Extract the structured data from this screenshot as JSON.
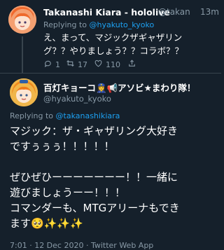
{
  "tweet1": {
    "display_name": "Takanashi Kiara - hololive",
    "handle": "@takan",
    "time": "13m",
    "replying_prefix": "Replying to ",
    "replying_handle": "@hyakuto_kyoko",
    "text_line1": "え、まって、マジックザギャザリン",
    "text_line2": "グ？？やりましょう？？コラボ？？",
    "replies": "1",
    "retweets": "17",
    "likes": "110"
  },
  "tweet2": {
    "display_name": "百灯キョーコ👮‍♀️📢アソビ★まわり隊！",
    "handle": "@hyakuto_kyoko",
    "replying_prefix": "Replying to ",
    "replying_handle": "@takanashikiara",
    "lines": [
      "マジック：ザ・ギャザリング大好き",
      "ですぅぅぅ！！！！！",
      "ぜひぜひーーーーーーー！！一緒に",
      "遊びましょうーー！！！",
      "コマンダーも、MTGアリーナもでき",
      "ます🥺✨✨✨"
    ],
    "footer": "7:01 · 12 Dec 2020 · Twitter Web App"
  },
  "colors": {
    "background": "#15202b",
    "secondary_text": "#8899a6",
    "link": "#1da1f2",
    "divider": "#38444d"
  }
}
